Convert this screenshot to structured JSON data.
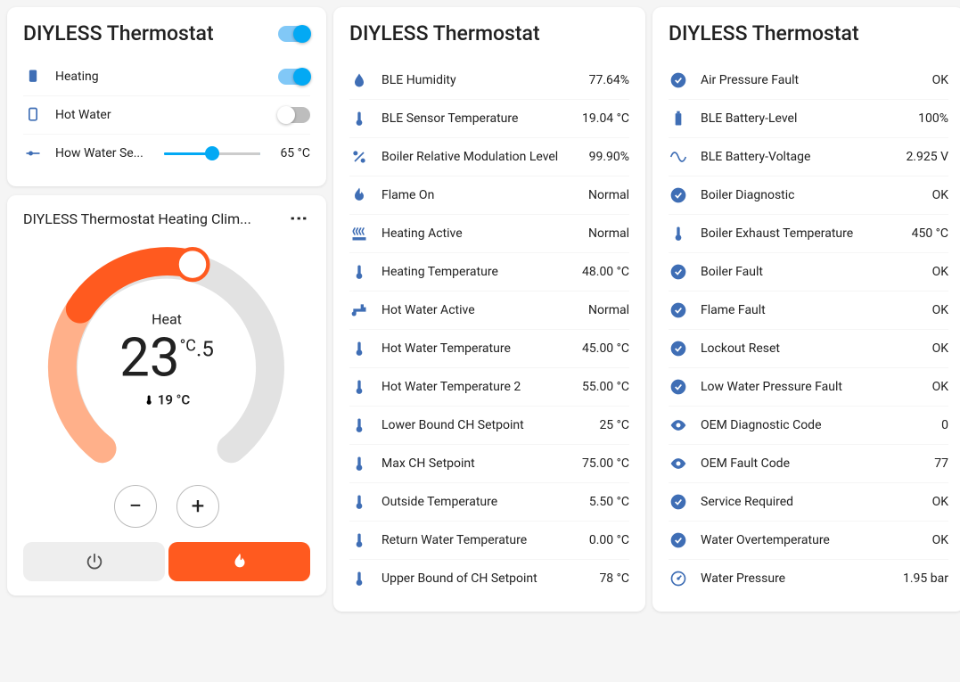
{
  "card1": {
    "title": "DIYLESS Thermostat",
    "master_on": true,
    "rows": [
      {
        "icon": "device-filled",
        "label": "Heating",
        "on": true
      },
      {
        "icon": "device-outline",
        "label": "Hot Water",
        "on": false
      }
    ],
    "slider": {
      "label": "How Water Se...",
      "value": "65 °C",
      "pct": 50
    }
  },
  "climate": {
    "title": "DIYLESS Thermostat Heating Clim...",
    "mode": "Heat",
    "set_int": "23",
    "set_dec": ".5",
    "unit": "°C",
    "current": "19 °C"
  },
  "sensors1": {
    "title": "DIYLESS Thermostat",
    "rows": [
      {
        "icon": "humidity",
        "label": "BLE Humidity",
        "val": "77.64%"
      },
      {
        "icon": "therm",
        "label": "BLE Sensor Temperature",
        "val": "19.04 °C"
      },
      {
        "icon": "percent",
        "label": "Boiler Relative Modulation Level",
        "val": "99.90%"
      },
      {
        "icon": "flame",
        "label": "Flame On",
        "val": "Normal"
      },
      {
        "icon": "radiator",
        "label": "Heating Active",
        "val": "Normal"
      },
      {
        "icon": "therm",
        "label": "Heating Temperature",
        "val": "48.00 °C"
      },
      {
        "icon": "faucet",
        "label": "Hot Water Active",
        "val": "Normal"
      },
      {
        "icon": "therm",
        "label": "Hot Water Temperature",
        "val": "45.00 °C"
      },
      {
        "icon": "therm",
        "label": "Hot Water Temperature 2",
        "val": "55.00 °C"
      },
      {
        "icon": "therm",
        "label": "Lower Bound CH Setpoint",
        "val": "25 °C"
      },
      {
        "icon": "therm",
        "label": "Max CH Setpoint",
        "val": "75.00 °C"
      },
      {
        "icon": "therm",
        "label": "Outside Temperature",
        "val": "5.50 °C"
      },
      {
        "icon": "therm",
        "label": "Return Water Temperature",
        "val": "0.00 °C"
      },
      {
        "icon": "therm",
        "label": "Upper Bound of CH Setpoint",
        "val": "78 °C"
      }
    ]
  },
  "sensors2": {
    "title": "DIYLESS Thermostat",
    "rows": [
      {
        "icon": "check",
        "label": "Air Pressure Fault",
        "val": "OK"
      },
      {
        "icon": "battery",
        "label": "BLE Battery-Level",
        "val": "100%"
      },
      {
        "icon": "sine",
        "label": "BLE Battery-Voltage",
        "val": "2.925 V"
      },
      {
        "icon": "check",
        "label": "Boiler Diagnostic",
        "val": "OK"
      },
      {
        "icon": "therm",
        "label": "Boiler Exhaust Temperature",
        "val": "450 °C"
      },
      {
        "icon": "check",
        "label": "Boiler Fault",
        "val": "OK"
      },
      {
        "icon": "check",
        "label": "Flame Fault",
        "val": "OK"
      },
      {
        "icon": "check",
        "label": "Lockout Reset",
        "val": "OK"
      },
      {
        "icon": "check",
        "label": "Low Water Pressure Fault",
        "val": "OK"
      },
      {
        "icon": "eye",
        "label": "OEM Diagnostic Code",
        "val": "0"
      },
      {
        "icon": "eye",
        "label": "OEM Fault Code",
        "val": "77"
      },
      {
        "icon": "check",
        "label": "Service Required",
        "val": "OK"
      },
      {
        "icon": "check",
        "label": "Water Overtemperature",
        "val": "OK"
      },
      {
        "icon": "gauge",
        "label": "Water Pressure",
        "val": "1.95 bar"
      }
    ]
  }
}
